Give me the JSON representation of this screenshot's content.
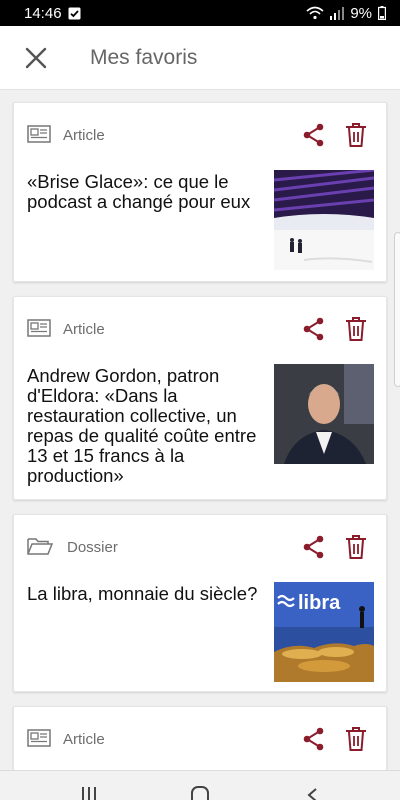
{
  "status_bar": {
    "time": "14:46",
    "battery": "9%"
  },
  "header": {
    "title": "Mes favoris"
  },
  "cards": [
    {
      "type_label": "Article",
      "title": "«Brise Glace»: ce que le podcast a changé pour eux"
    },
    {
      "type_label": "Article",
      "title": "Andrew Gordon, patron d'Eldora: «Dans la restauration collective, un repas de qualité coûte entre 13 et 15 francs à la production»"
    },
    {
      "type_label": "Dossier",
      "title": "La libra, monnaie du siècle?",
      "thumb_text": "libra"
    },
    {
      "type_label": "Article"
    }
  ],
  "colors": {
    "accent": "#8a1c2b",
    "icon_gray": "#777777"
  },
  "icons": {
    "close": "close-icon",
    "article": "newspaper-icon",
    "dossier": "folder-icon",
    "share": "share-icon",
    "delete": "trash-icon"
  }
}
